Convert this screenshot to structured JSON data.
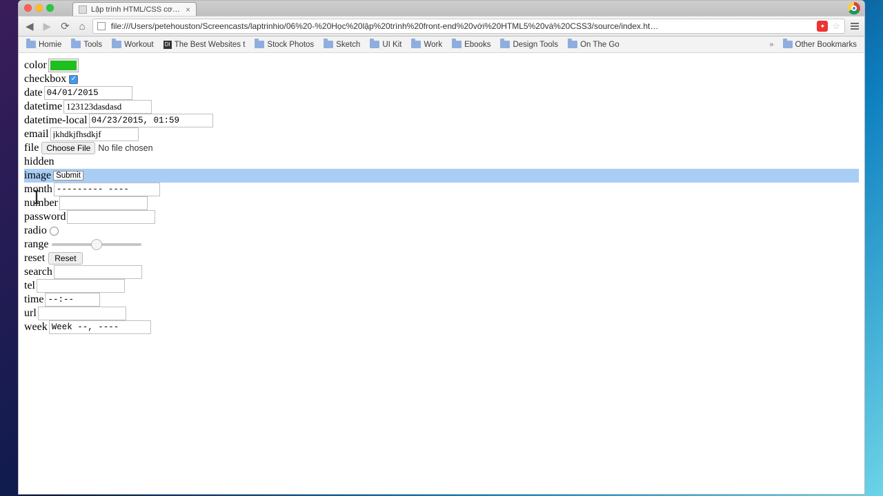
{
  "browser": {
    "tab_title": "Lập trình HTML/CSS cơ bản",
    "url": "file:///Users/petehouston/Screencasts/laptrinhio/06%20-%20Học%20lập%20trình%20front-end%20với%20HTML5%20và%20CSS3/source/index.ht…",
    "bookmarks": [
      "Homie",
      "Tools",
      "Workout",
      "The Best Websites t",
      "Stock Photos",
      "Sketch",
      "UI Kit",
      "Work",
      "Ebooks",
      "Design Tools",
      "On The Go"
    ],
    "bookmarks_overflow": "»",
    "other_bookmarks": "Other Bookmarks"
  },
  "labels": {
    "color": "color",
    "checkbox": "checkbox",
    "date": "date",
    "datetime": "datetime",
    "datetime_local": "datetime-local",
    "email": "email",
    "file": "file",
    "hidden": "hidden",
    "image": "image",
    "month": "month",
    "number": "number",
    "password": "password",
    "radio": "radio",
    "range": "range",
    "reset": "reset",
    "search": "search",
    "tel": "tel",
    "time": "time",
    "url": "url",
    "week": "week"
  },
  "values": {
    "color": "#1fbf1f",
    "date": "04/01/2015",
    "datetime": "123123dasdasd",
    "datetime_local": "04/23/2015, 01:59",
    "email": "jkhdkjfhsdkjf",
    "file_button": "Choose File",
    "file_text": "No file chosen",
    "image_submit": "Submit",
    "month": "--------- ----",
    "reset": "Reset",
    "time": "--:--",
    "week": "Week --, ----"
  }
}
